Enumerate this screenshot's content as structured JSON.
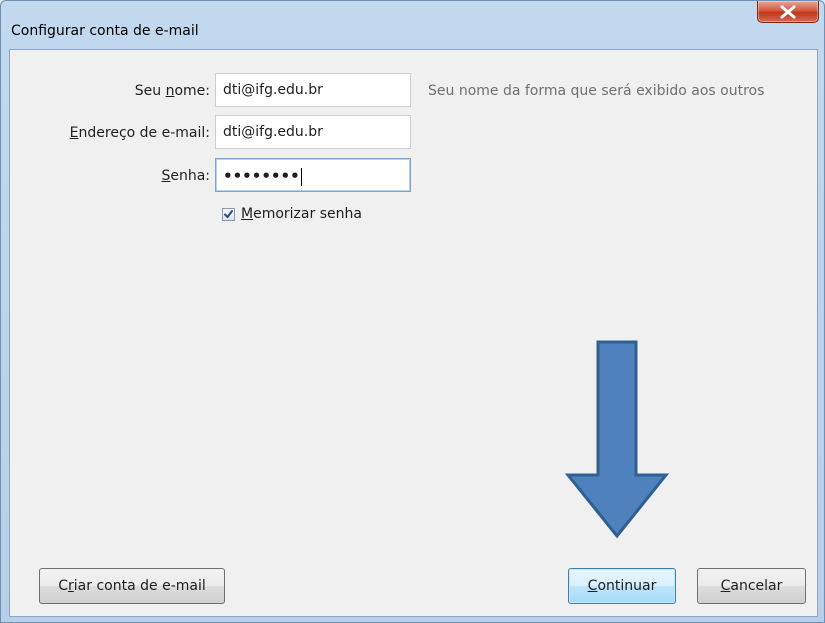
{
  "window": {
    "title": "Configurar conta de e-mail"
  },
  "form": {
    "name": {
      "label_pre": "Seu ",
      "label_key": "n",
      "label_post": "ome:",
      "value": "dti@ifg.edu.br",
      "hint": "Seu nome da forma que será exibido aos outros"
    },
    "email": {
      "label_pre": "",
      "label_key": "E",
      "label_post": "ndereço de e-mail:",
      "value": "dti@ifg.edu.br"
    },
    "password": {
      "label_pre": "",
      "label_key": "S",
      "label_post": "enha:",
      "value": "••••••••"
    },
    "remember": {
      "checked": true,
      "label_pre": "",
      "label_key": "M",
      "label_post": "emorizar senha"
    }
  },
  "buttons": {
    "create": {
      "label_pre": "C",
      "label_key": "r",
      "label_post": "iar conta de e-mail"
    },
    "continue": {
      "label_pre": "",
      "label_key": "C",
      "label_post": "ontinuar"
    },
    "cancel": {
      "label_pre": "",
      "label_key": "C",
      "label_post": "ancelar"
    }
  },
  "colors": {
    "arrow_fill": "#4f81bd",
    "arrow_stroke": "#2f5f93",
    "close_button": "#c7432a"
  }
}
